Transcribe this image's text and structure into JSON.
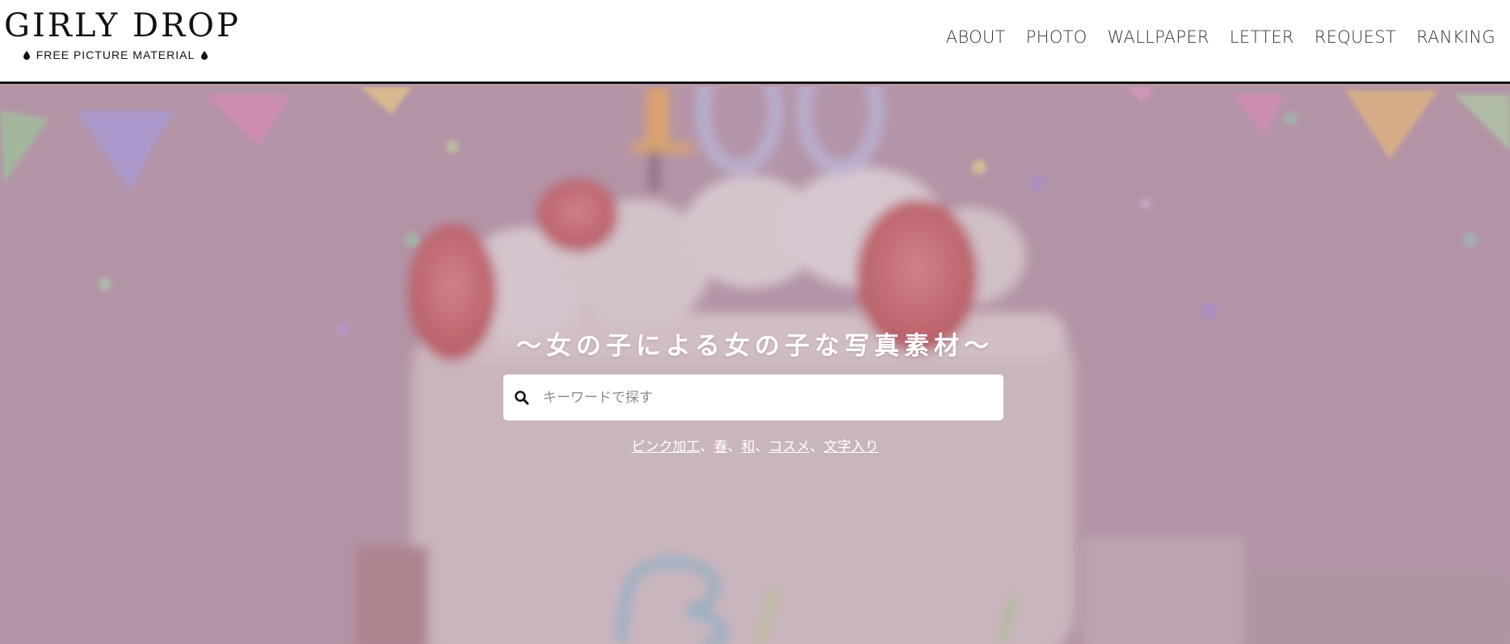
{
  "header": {
    "logo": {
      "title": "GIRLY DROP",
      "subtitle": "FREE PICTURE MATERIAL"
    },
    "nav": [
      {
        "label": "ABOUT"
      },
      {
        "label": "PHOTO"
      },
      {
        "label": "WALLPAPER"
      },
      {
        "label": "LETTER"
      },
      {
        "label": "REQUEST"
      },
      {
        "label": "RANKING"
      }
    ]
  },
  "hero": {
    "background": "pink birthday cake with strawberries, candles and bunting, blurred",
    "tagline": "〜女の子による女の子な写真素材〜",
    "search": {
      "icon": "search-icon",
      "placeholder": "キーワードで探す",
      "value": ""
    },
    "tags": [
      {
        "label": "ピンク加工"
      },
      {
        "label": "春"
      },
      {
        "label": "和"
      },
      {
        "label": "コスメ"
      },
      {
        "label": "文字入り"
      }
    ],
    "tag_separator": "、"
  },
  "colors": {
    "header_bg": "#ffffff",
    "header_border": "#111111",
    "nav_text": "#333333",
    "hero_tint": "#b89aa8",
    "text_on_hero": "#ffffff"
  }
}
